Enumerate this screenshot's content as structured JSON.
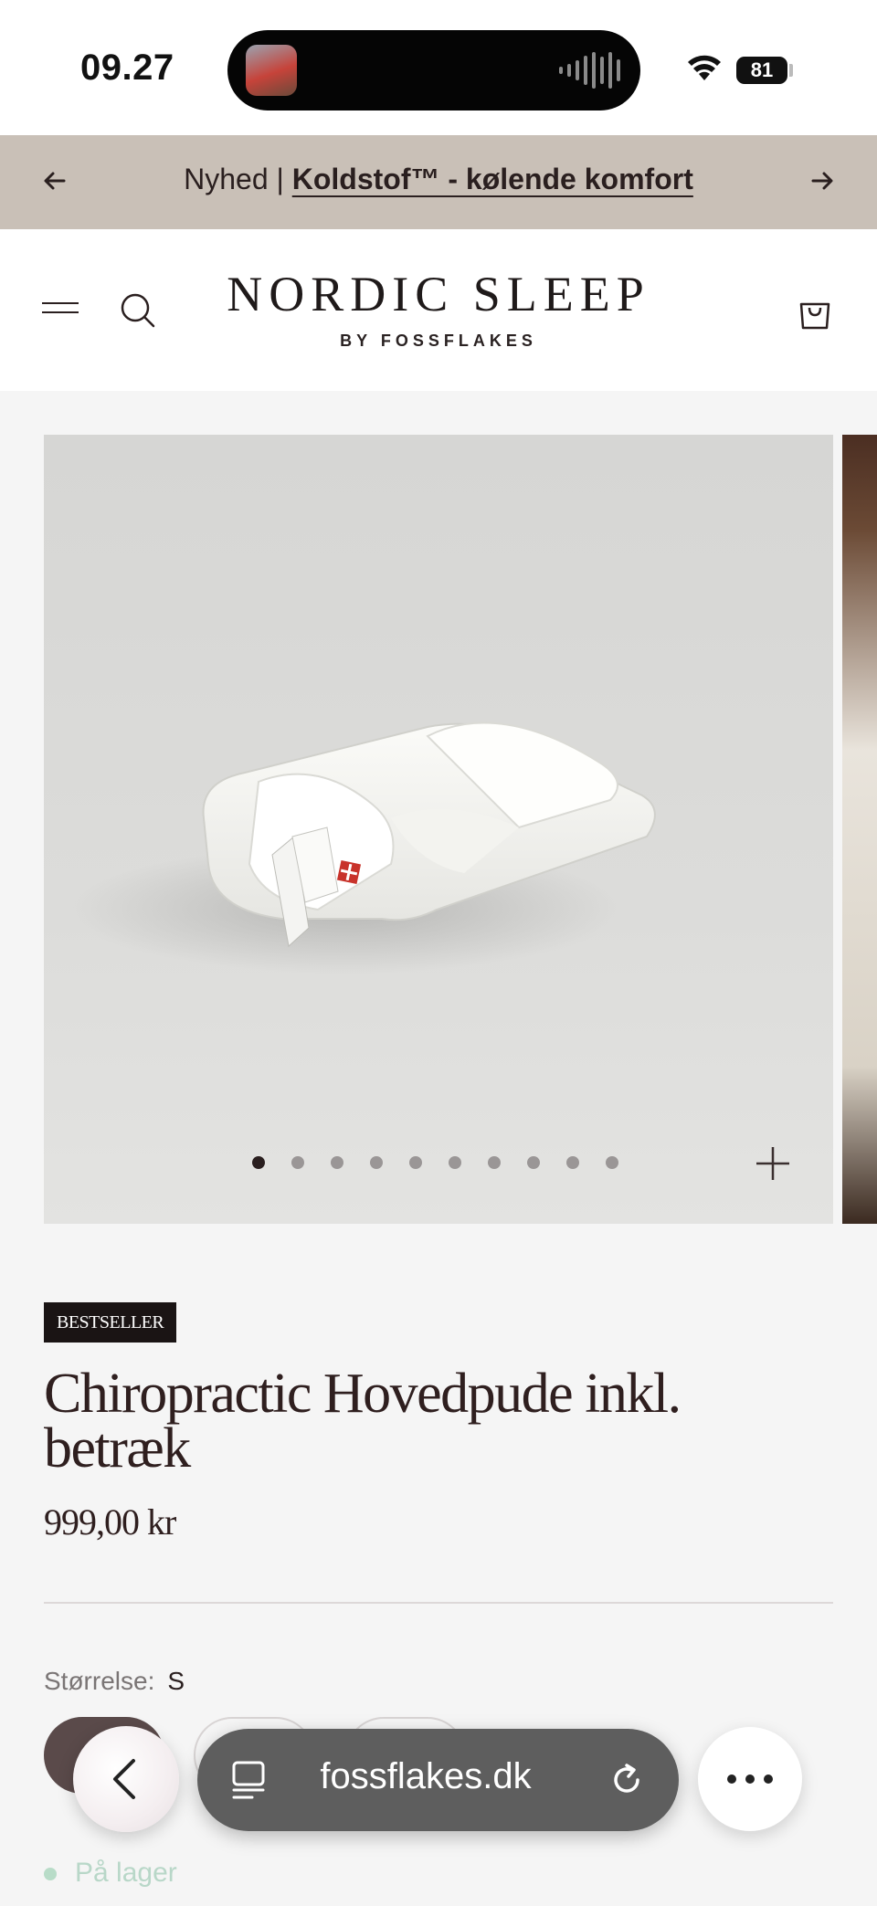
{
  "status_bar": {
    "time": "09.27",
    "battery": "81",
    "icons": [
      "media-thumbnail-icon",
      "audio-wave-icon",
      "wifi-icon",
      "battery-icon"
    ]
  },
  "announcement": {
    "prefix": "Nyhed |",
    "link": "Koldstof™ - kølende komfort",
    "icons": [
      "arrow-left-icon",
      "arrow-right-icon"
    ]
  },
  "header": {
    "logo_main": "NORDIC SLEEP",
    "logo_sub": "BY FOSSFLAKES",
    "icons": [
      "menu-icon",
      "search-icon",
      "cart-icon"
    ]
  },
  "gallery": {
    "image_count": 10,
    "active_index": 0,
    "icons": [
      "zoom-plus-icon"
    ]
  },
  "product": {
    "badge": "BESTSELLER",
    "title": "Chiropractic Hovedpude inkl. betræk",
    "price": "999,00 kr",
    "size_label": "Størrelse:",
    "size_value": "S",
    "stock": "På lager"
  },
  "browser": {
    "url": "fossflakes.dk",
    "icons": [
      "back-chevron-icon",
      "reader-icon",
      "reload-icon",
      "more-icon"
    ]
  }
}
